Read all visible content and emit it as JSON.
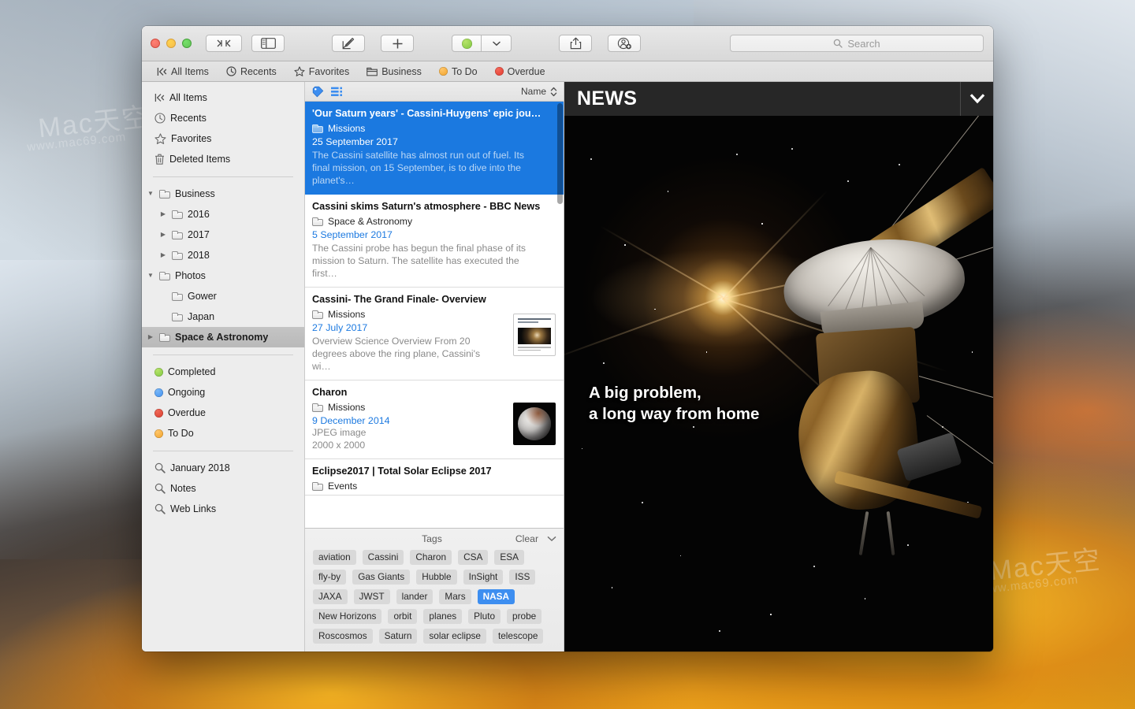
{
  "window": {
    "traffic_lights": [
      "close",
      "minimize",
      "zoom"
    ],
    "toolbar": {
      "sidebar_toggle_label": ">|<",
      "view_panes_label": "panes",
      "compose_label": "compose",
      "add_label": "+",
      "tag_color_label": "green",
      "tag_dropdown_label": "chevron",
      "share_label": "share",
      "collaborate_label": "collaborate"
    },
    "search": {
      "placeholder": "Search",
      "value": ""
    }
  },
  "tabbar": {
    "items": [
      {
        "label": "All Items",
        "icon": "all-items-icon",
        "color": ""
      },
      {
        "label": "Recents",
        "icon": "clock-icon",
        "color": ""
      },
      {
        "label": "Favorites",
        "icon": "star-icon",
        "color": ""
      },
      {
        "label": "Business",
        "icon": "folder-icon",
        "color": ""
      },
      {
        "label": "To Do",
        "icon": "dot-icon",
        "color": "#f0a128"
      },
      {
        "label": "Overdue",
        "icon": "dot-icon",
        "color": "#e0382c"
      }
    ]
  },
  "sidebar": {
    "top_items": [
      {
        "label": "All Items",
        "icon": "all-items-icon"
      },
      {
        "label": "Recents",
        "icon": "clock-icon"
      },
      {
        "label": "Favorites",
        "icon": "star-icon"
      },
      {
        "label": "Deleted Items",
        "icon": "trash-icon"
      }
    ],
    "folders": [
      {
        "label": "Business",
        "level": 1,
        "disclosure": "open",
        "selected": false
      },
      {
        "label": "2016",
        "level": 2,
        "disclosure": "closed",
        "selected": false
      },
      {
        "label": "2017",
        "level": 2,
        "disclosure": "closed",
        "selected": false
      },
      {
        "label": "2018",
        "level": 2,
        "disclosure": "closed",
        "selected": false
      },
      {
        "label": "Photos",
        "level": 1,
        "disclosure": "open",
        "selected": false
      },
      {
        "label": "Gower",
        "level": 2,
        "disclosure": "none",
        "selected": false
      },
      {
        "label": "Japan",
        "level": 2,
        "disclosure": "none",
        "selected": false
      },
      {
        "label": "Space & Astronomy",
        "level": 1,
        "disclosure": "closed",
        "selected": true
      }
    ],
    "statuses": [
      {
        "label": "Completed",
        "color": "#7cc63e"
      },
      {
        "label": "Ongoing",
        "color": "#3d8ef0"
      },
      {
        "label": "Overdue",
        "color": "#d93a2b"
      },
      {
        "label": "To Do",
        "color": "#f0a128"
      }
    ],
    "saved_searches": [
      {
        "label": "January 2018",
        "icon": "magnifier-icon"
      },
      {
        "label": "Notes",
        "icon": "magnifier-icon"
      },
      {
        "label": "Web Links",
        "icon": "magnifier-icon"
      }
    ]
  },
  "list": {
    "header": {
      "tag_icon": "tag-icon",
      "list_view_icon": "list-view-icon",
      "sort_label": "Name",
      "sort_icon": "sort-chevrons-icon"
    },
    "rows": [
      {
        "title": "'Our Saturn years' - Cassini-Huygens' epic jou…",
        "folder": "Missions",
        "date": "25 September 2017",
        "snippet": "The Cassini satellite has almost run out of fuel. Its final mission, on 15 September, is to dive into the planet's…",
        "selected": true,
        "thumb": "none"
      },
      {
        "title": "Cassini skims Saturn's atmosphere - BBC News",
        "folder": "Space & Astronomy",
        "date": "5 September 2017",
        "snippet": "The Cassini probe has begun the final phase of its mission to Saturn. The satellite has executed the first…",
        "selected": false,
        "thumb": "none"
      },
      {
        "title": "Cassini- The Grand Finale- Overview",
        "folder": "Missions",
        "date": "27 July 2017",
        "snippet": "Overview Science Overview From 20 degrees above the ring plane, Cassini's wi…",
        "selected": false,
        "thumb": "document"
      },
      {
        "title": "Charon",
        "folder": "Missions",
        "date": "9 December 2014",
        "filetype": "JPEG image",
        "dimensions": "2000 x 2000",
        "selected": false,
        "thumb": "image"
      },
      {
        "title": "Eclipse2017 | Total Solar Eclipse 2017",
        "folder": "Events",
        "selected": false,
        "thumb": "none"
      }
    ]
  },
  "tags_panel": {
    "title": "Tags",
    "clear_label": "Clear",
    "collapse_icon": "chevron-down-icon",
    "tags": [
      {
        "label": "aviation",
        "selected": false
      },
      {
        "label": "Cassini",
        "selected": false
      },
      {
        "label": "Charon",
        "selected": false
      },
      {
        "label": "CSA",
        "selected": false
      },
      {
        "label": "ESA",
        "selected": false
      },
      {
        "label": "fly-by",
        "selected": false
      },
      {
        "label": "Gas Giants",
        "selected": false
      },
      {
        "label": "Hubble",
        "selected": false
      },
      {
        "label": "InSight",
        "selected": false
      },
      {
        "label": "ISS",
        "selected": false
      },
      {
        "label": "JAXA",
        "selected": false
      },
      {
        "label": "JWST",
        "selected": false
      },
      {
        "label": "lander",
        "selected": false
      },
      {
        "label": "Mars",
        "selected": false
      },
      {
        "label": "NASA",
        "selected": true
      },
      {
        "label": "New Horizons",
        "selected": false
      },
      {
        "label": "orbit",
        "selected": false
      },
      {
        "label": "planes",
        "selected": false
      },
      {
        "label": "Pluto",
        "selected": false
      },
      {
        "label": "probe",
        "selected": false
      },
      {
        "label": "Roscosmos",
        "selected": false
      },
      {
        "label": "Saturn",
        "selected": false
      },
      {
        "label": "solar eclipse",
        "selected": false
      },
      {
        "label": "telescope",
        "selected": false
      }
    ]
  },
  "preview": {
    "brand": "NEWS",
    "collapse_icon": "chevron-down-icon",
    "headline_line1": "A big problem,",
    "headline_line2": "a long way from home",
    "image_alt": "cassini-spacecraft-illustration"
  },
  "desktop": {
    "watermark_main": "Mac天空",
    "watermark_sub": "www.mac69.com"
  },
  "colors": {
    "selection_blue": "#1b79e0",
    "tag_selected": "#3d8ef0",
    "date_link": "#1d7ae0",
    "news_bar": "#272727"
  }
}
